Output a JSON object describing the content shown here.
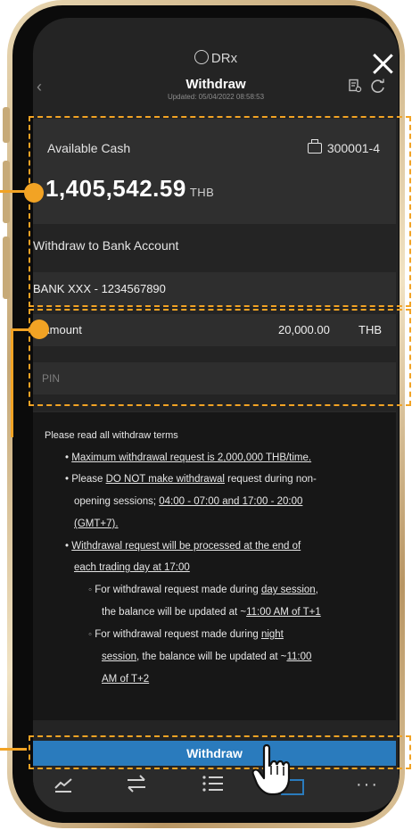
{
  "app": {
    "brand": "DRx"
  },
  "header": {
    "title": "Withdraw",
    "updated": "Updated: 05/04/2022 08:58:53",
    "back": "‹"
  },
  "cash": {
    "label": "Available Cash",
    "account": "300001-4",
    "amount": "1,405,542.59",
    "currency": "THB"
  },
  "bank": {
    "label": "Withdraw to Bank Account",
    "value": "BANK XXX - 1234567890"
  },
  "amount": {
    "label": "Amount",
    "value": "20,000.00",
    "currency": "THB"
  },
  "pin": {
    "placeholder": "PIN"
  },
  "terms": {
    "heading": "Please read all withdraw terms",
    "b1": "Maximum withdrawal request is 2,000,000 THB/time.",
    "b2a": "Please ",
    "b2b": "DO NOT make withdrawal",
    "b2c": " request during non-",
    "b2d": "opening sessions; ",
    "b2e": "04:00 - 07:00 and 17:00 - 20:00",
    "b2f": "(GMT+7).",
    "b3a": "Withdrawal request will be processed at the end of",
    "b3b": "each trading day at 17:00",
    "s1a": "For withdrawal request made during ",
    "s1b": "day session",
    "s1c": ",",
    "s1d": "the balance will be updated at ~",
    "s1e": "11:00 AM of T+1",
    "s2a": "For withdrawal request made during ",
    "s2b": "night",
    "s2c": "session",
    "s2d": ", the balance will be updated at ~",
    "s2e": "11:00",
    "s2f": "AM of T+2"
  },
  "button": {
    "label": "Withdraw"
  },
  "colors": {
    "accent": "#2a7bbd",
    "highlight": "#f2a324",
    "background": "#242424"
  },
  "tabs": [
    "chart-icon",
    "transfer-icon",
    "list-icon",
    "wallet-icon",
    "more-icon"
  ]
}
